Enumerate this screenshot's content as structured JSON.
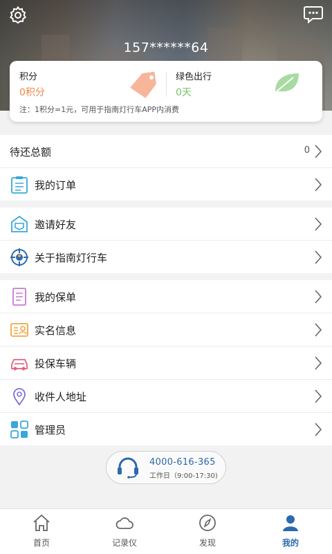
{
  "header": {
    "phone": "157******64"
  },
  "card": {
    "points_label": "积分",
    "points_value": "0积分",
    "green_label": "绿色出行",
    "green_value": "0天",
    "note": "注：1积分=1元，可用于指南灯行车APP内消费",
    "points_color": "#f0874a",
    "green_color": "#7ac36a"
  },
  "section1": {
    "balance_label": "待还总额",
    "balance_value": "0",
    "orders_label": "我的订单"
  },
  "section2": {
    "invite_label": "邀请好友",
    "about_label": "关于指南灯行车"
  },
  "section3": {
    "policy_label": "我的保单",
    "realname_label": "实名信息",
    "vehicle_label": "投保车辆",
    "address_label": "收件人地址",
    "admin_label": "管理员"
  },
  "hotline": {
    "number": "4000-616-365",
    "hours": "工作日（9:00-17:30)"
  },
  "tabbar": {
    "home": "首页",
    "recorder": "记录仪",
    "discover": "发现",
    "mine": "我的",
    "active": "mine",
    "accent": "#2b69b0"
  }
}
